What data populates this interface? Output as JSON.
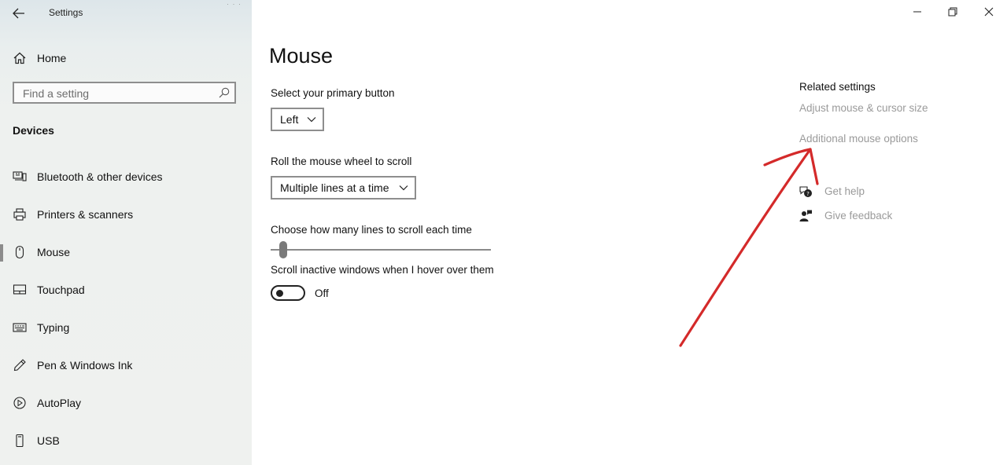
{
  "window": {
    "title": "Settings"
  },
  "sidebar": {
    "home_label": "Home",
    "search_placeholder": "Find a setting",
    "section_title": "Devices",
    "items": [
      {
        "label": "Bluetooth & other devices",
        "icon": "bluetooth-devices-icon"
      },
      {
        "label": "Printers & scanners",
        "icon": "printer-icon"
      },
      {
        "label": "Mouse",
        "icon": "mouse-icon",
        "selected": true
      },
      {
        "label": "Touchpad",
        "icon": "touchpad-icon"
      },
      {
        "label": "Typing",
        "icon": "keyboard-icon"
      },
      {
        "label": "Pen & Windows Ink",
        "icon": "pen-icon"
      },
      {
        "label": "AutoPlay",
        "icon": "autoplay-icon"
      },
      {
        "label": "USB",
        "icon": "usb-icon"
      }
    ]
  },
  "main": {
    "title": "Mouse",
    "primary_button_label": "Select your primary button",
    "primary_button_value": "Left",
    "scroll_label": "Roll the mouse wheel to scroll",
    "scroll_value": "Multiple lines at a time",
    "lines_label": "Choose how many lines to scroll each time",
    "lines_slider_value": 0.03,
    "inactive_label": "Scroll inactive windows when I hover over them",
    "inactive_state": "Off"
  },
  "related": {
    "heading": "Related settings",
    "links": [
      "Adjust mouse & cursor size",
      "Additional mouse options"
    ],
    "get_help": "Get help",
    "give_feedback": "Give feedback"
  },
  "colors": {
    "link_gray": "#9a9a9a",
    "annotation_red": "#d42a2a",
    "sidebar_bg": "#eff1ef"
  }
}
